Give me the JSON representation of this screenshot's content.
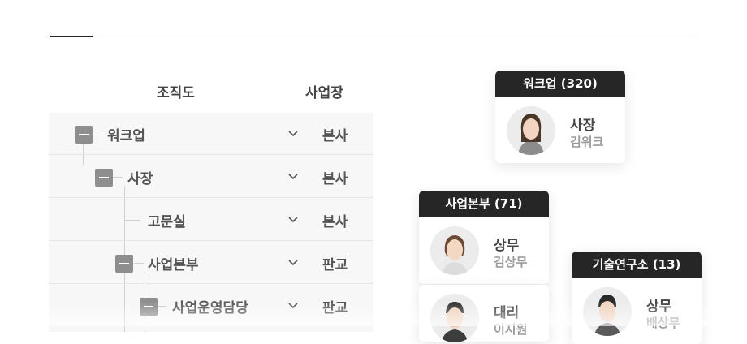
{
  "tree": {
    "header_org": "조직도",
    "header_site": "사업장",
    "rows": [
      {
        "label": "워크업",
        "site": "본사"
      },
      {
        "label": "사장",
        "site": "본사"
      },
      {
        "label": "고문실",
        "site": "본사"
      },
      {
        "label": "사업본부",
        "site": "판교"
      },
      {
        "label": "사업운영담당",
        "site": "판교"
      }
    ]
  },
  "cards": [
    {
      "group": "워크업 (320)",
      "title": "사장",
      "name": "김워크"
    },
    {
      "group": "사업본부 (71)",
      "title": "상무",
      "name": "김상무"
    },
    {
      "title": "대리",
      "name": "이지원"
    },
    {
      "group": "기술연구소 (13)",
      "title": "상무",
      "name": "배상무"
    }
  ],
  "colors": {
    "card_header": "#262626",
    "tree_bg": "#f7f7f7",
    "toggle": "#8e8e8e"
  }
}
